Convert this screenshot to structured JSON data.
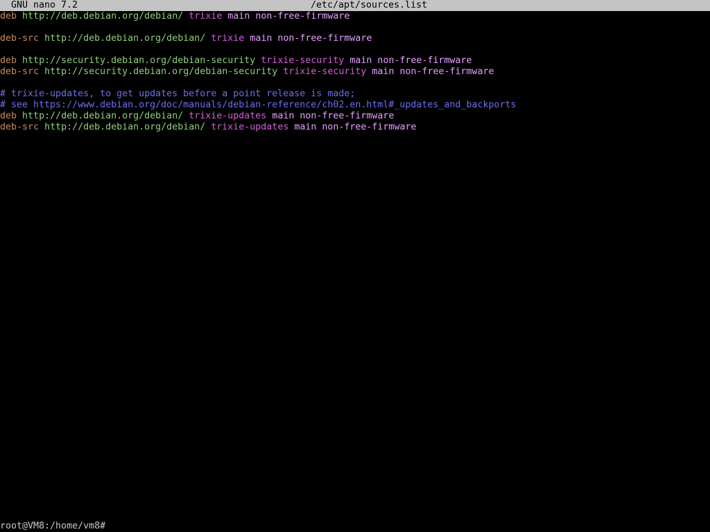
{
  "titlebar": {
    "app": "GNU nano 7.2",
    "file": "/etc/apt/sources.list"
  },
  "colors": {
    "background": "#000000",
    "titlebar_bg": "#c4c4c4",
    "keyword": "#c98b5a",
    "url": "#8fd07e",
    "suite": "#d45fd4",
    "components": "#e6a0ff",
    "comment": "#6e6ef0"
  },
  "lines": [
    [
      [
        "kw",
        "deb"
      ],
      [
        "plain",
        " "
      ],
      [
        "url",
        "http://deb.debian.org/debian/"
      ],
      [
        "plain",
        " "
      ],
      [
        "suite",
        "trixie"
      ],
      [
        "plain",
        " "
      ],
      [
        "comp",
        "main non-free-firmware"
      ]
    ],
    [],
    [
      [
        "kw",
        "deb-src"
      ],
      [
        "plain",
        " "
      ],
      [
        "url",
        "http://deb.debian.org/debian/"
      ],
      [
        "plain",
        " "
      ],
      [
        "suite",
        "trixie"
      ],
      [
        "plain",
        " "
      ],
      [
        "comp",
        "main non-free-firmware"
      ]
    ],
    [],
    [
      [
        "kw",
        "deb"
      ],
      [
        "plain",
        " "
      ],
      [
        "url",
        "http://security.debian.org/debian-security"
      ],
      [
        "plain",
        " "
      ],
      [
        "suite",
        "trixie-security"
      ],
      [
        "plain",
        " "
      ],
      [
        "comp",
        "main non-free-firmware"
      ]
    ],
    [
      [
        "kw",
        "deb-src"
      ],
      [
        "plain",
        " "
      ],
      [
        "url",
        "http://security.debian.org/debian-security"
      ],
      [
        "plain",
        " "
      ],
      [
        "suite",
        "trixie-security"
      ],
      [
        "plain",
        " "
      ],
      [
        "comp",
        "main non-free-firmware"
      ]
    ],
    [],
    [
      [
        "comment",
        "# trixie-updates, to get updates before a point release is made;"
      ]
    ],
    [
      [
        "comment",
        "# see https://www.debian.org/doc/manuals/debian-reference/ch02.en.html#_updates_and_backports"
      ]
    ],
    [
      [
        "kw",
        "deb"
      ],
      [
        "plain",
        " "
      ],
      [
        "url",
        "http://deb.debian.org/debian/"
      ],
      [
        "plain",
        " "
      ],
      [
        "suite",
        "trixie-updates"
      ],
      [
        "plain",
        " "
      ],
      [
        "comp",
        "main non-free-firmware"
      ]
    ],
    [
      [
        "kw",
        "deb-src"
      ],
      [
        "plain",
        " "
      ],
      [
        "url",
        "http://deb.debian.org/debian/"
      ],
      [
        "plain",
        " "
      ],
      [
        "suite",
        "trixie-updates"
      ],
      [
        "plain",
        " "
      ],
      [
        "comp",
        "main non-free-firmware"
      ]
    ]
  ],
  "prompt": "root@VM8:/home/vm8#"
}
